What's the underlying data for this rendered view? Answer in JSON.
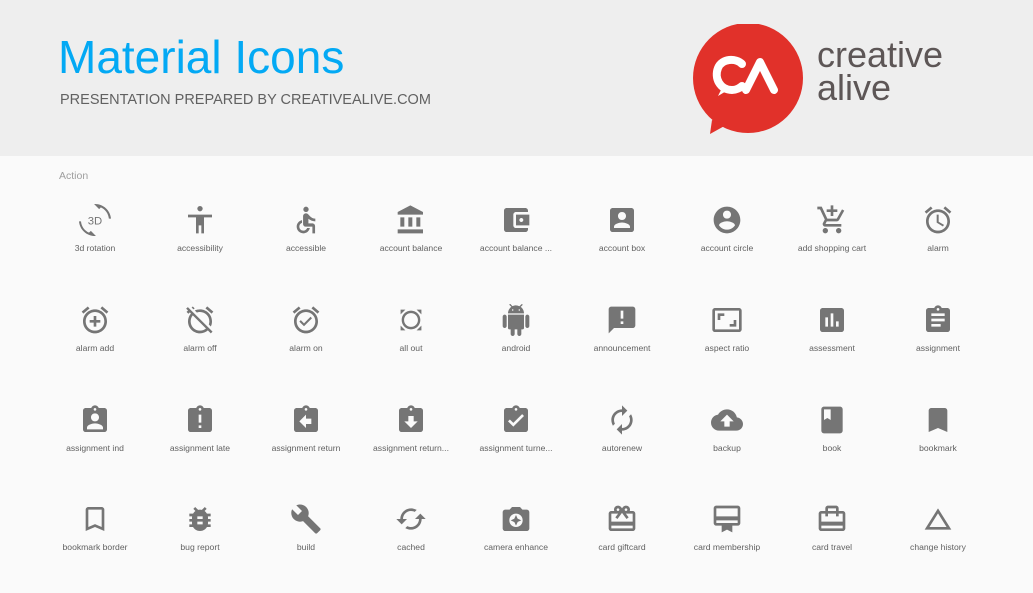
{
  "header": {
    "title": "Material Icons",
    "subtitle": "PRESENTATION PREPARED BY CREATIVEALIVE.COM",
    "logo": {
      "monogram": "CA",
      "line1": "creative",
      "line2": "alive",
      "brand_color": "#e1312a"
    },
    "title_color": "#03a9f4"
  },
  "section": {
    "label": "Action",
    "icon_color": "#757575",
    "icons": [
      {
        "label": "3d rotation",
        "icon": "3d-rotation-icon"
      },
      {
        "label": "accessibility",
        "icon": "accessibility-icon"
      },
      {
        "label": "accessible",
        "icon": "accessible-icon"
      },
      {
        "label": "account balance",
        "icon": "account-balance-icon"
      },
      {
        "label": "account balance ...",
        "icon": "account-balance-wallet-icon"
      },
      {
        "label": "account box",
        "icon": "account-box-icon"
      },
      {
        "label": "account circle",
        "icon": "account-circle-icon"
      },
      {
        "label": "add shopping cart",
        "icon": "add-shopping-cart-icon"
      },
      {
        "label": "alarm",
        "icon": "alarm-icon"
      },
      {
        "label": "alarm add",
        "icon": "alarm-add-icon"
      },
      {
        "label": "alarm off",
        "icon": "alarm-off-icon"
      },
      {
        "label": "alarm on",
        "icon": "alarm-on-icon"
      },
      {
        "label": "all out",
        "icon": "all-out-icon"
      },
      {
        "label": "android",
        "icon": "android-icon"
      },
      {
        "label": "announcement",
        "icon": "announcement-icon"
      },
      {
        "label": "aspect ratio",
        "icon": "aspect-ratio-icon"
      },
      {
        "label": "assessment",
        "icon": "assessment-icon"
      },
      {
        "label": "assignment",
        "icon": "assignment-icon"
      },
      {
        "label": "assignment ind",
        "icon": "assignment-ind-icon"
      },
      {
        "label": "assignment late",
        "icon": "assignment-late-icon"
      },
      {
        "label": "assignment return",
        "icon": "assignment-return-icon"
      },
      {
        "label": "assignment return...",
        "icon": "assignment-returned-icon"
      },
      {
        "label": "assignment turne...",
        "icon": "assignment-turned-in-icon"
      },
      {
        "label": "autorenew",
        "icon": "autorenew-icon"
      },
      {
        "label": "backup",
        "icon": "backup-icon"
      },
      {
        "label": "book",
        "icon": "book-icon"
      },
      {
        "label": "bookmark",
        "icon": "bookmark-icon"
      },
      {
        "label": "bookmark border",
        "icon": "bookmark-border-icon"
      },
      {
        "label": "bug report",
        "icon": "bug-report-icon"
      },
      {
        "label": "build",
        "icon": "build-icon"
      },
      {
        "label": "cached",
        "icon": "cached-icon"
      },
      {
        "label": "camera enhance",
        "icon": "camera-enhance-icon"
      },
      {
        "label": "card giftcard",
        "icon": "card-giftcard-icon"
      },
      {
        "label": "card membership",
        "icon": "card-membership-icon"
      },
      {
        "label": "card travel",
        "icon": "card-travel-icon"
      },
      {
        "label": "change history",
        "icon": "change-history-icon"
      }
    ]
  }
}
